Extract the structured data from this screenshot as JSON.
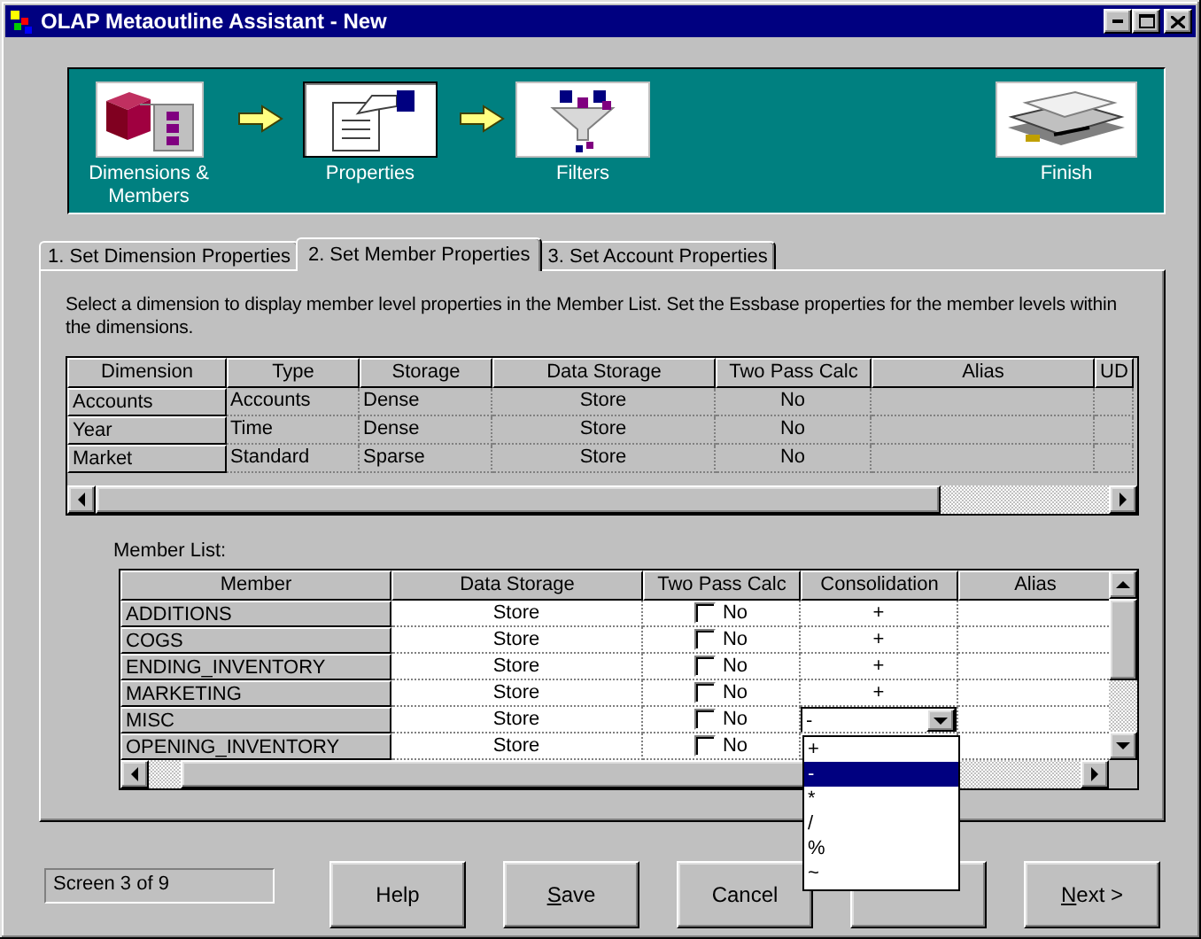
{
  "window": {
    "title": "OLAP Metaoutline Assistant - New"
  },
  "steps": [
    {
      "label": "Dimensions & Members",
      "kind": "cube",
      "selected": false,
      "arrow_after": true
    },
    {
      "label": "Properties",
      "kind": "form",
      "selected": true,
      "arrow_after": true
    },
    {
      "label": "Filters",
      "kind": "funnel",
      "selected": false,
      "arrow_after": false
    },
    {
      "label": "Finish",
      "kind": "stack",
      "selected": false,
      "arrow_after": false
    }
  ],
  "tabs": [
    {
      "label": "1. Set Dimension Properties",
      "selected": false
    },
    {
      "label": "2. Set Member Properties",
      "selected": true
    },
    {
      "label": "3. Set Account Properties",
      "selected": false
    }
  ],
  "description": "Select a dimension to display member level properties in the Member List. Set the Essbase properties for the member levels within the dimensions.",
  "dimension_table": {
    "columns": [
      "Dimension",
      "Type",
      "Storage",
      "Data Storage",
      "Two Pass Calc",
      "Alias",
      "UD"
    ],
    "rows": [
      [
        "Accounts",
        "Accounts",
        "Dense",
        "Store",
        "No"
      ],
      [
        "Year",
        "Time",
        "Dense",
        "Store",
        "No"
      ],
      [
        "Market",
        "Standard",
        "Sparse",
        "Store",
        "No"
      ]
    ]
  },
  "member_list": {
    "label": "Member List:",
    "columns": [
      "Member",
      "Data Storage",
      "Two Pass Calc",
      "Consolidation",
      "Alias"
    ],
    "rows": [
      {
        "member": "ADDITIONS",
        "data_storage": "Store",
        "two_pass_calc": {
          "checked": false,
          "label": "No"
        },
        "consolidation": "+",
        "editing": false
      },
      {
        "member": "COGS",
        "data_storage": "Store",
        "two_pass_calc": {
          "checked": false,
          "label": "No"
        },
        "consolidation": "+",
        "editing": false
      },
      {
        "member": "ENDING_INVENTORY",
        "data_storage": "Store",
        "two_pass_calc": {
          "checked": false,
          "label": "No"
        },
        "consolidation": "+",
        "editing": false
      },
      {
        "member": "MARKETING",
        "data_storage": "Store",
        "two_pass_calc": {
          "checked": false,
          "label": "No"
        },
        "consolidation": "+",
        "editing": false
      },
      {
        "member": "MISC",
        "data_storage": "Store",
        "two_pass_calc": {
          "checked": false,
          "label": "No"
        },
        "consolidation": "-",
        "editing": true
      },
      {
        "member": "OPENING_INVENTORY",
        "data_storage": "Store",
        "two_pass_calc": {
          "checked": false,
          "label": "No"
        },
        "editing": false
      }
    ],
    "dropdown_options": [
      {
        "label": "+",
        "selected": false
      },
      {
        "label": "-",
        "selected": true
      },
      {
        "label": "*",
        "selected": false
      },
      {
        "label": "/",
        "selected": false
      },
      {
        "label": "%",
        "selected": false
      },
      {
        "label": "~",
        "selected": false
      }
    ]
  },
  "status": "Screen 3 of 9",
  "buttons": [
    {
      "kind": "text",
      "label": "Help",
      "mnemonic": false
    },
    {
      "kind": "text",
      "label": "Save",
      "mnemonic": true
    },
    {
      "kind": "text",
      "label": "Cancel",
      "mnemonic": false
    },
    {
      "kind": "blank"
    },
    {
      "kind": "text",
      "label": "Next >",
      "mnemonic": true
    }
  ]
}
